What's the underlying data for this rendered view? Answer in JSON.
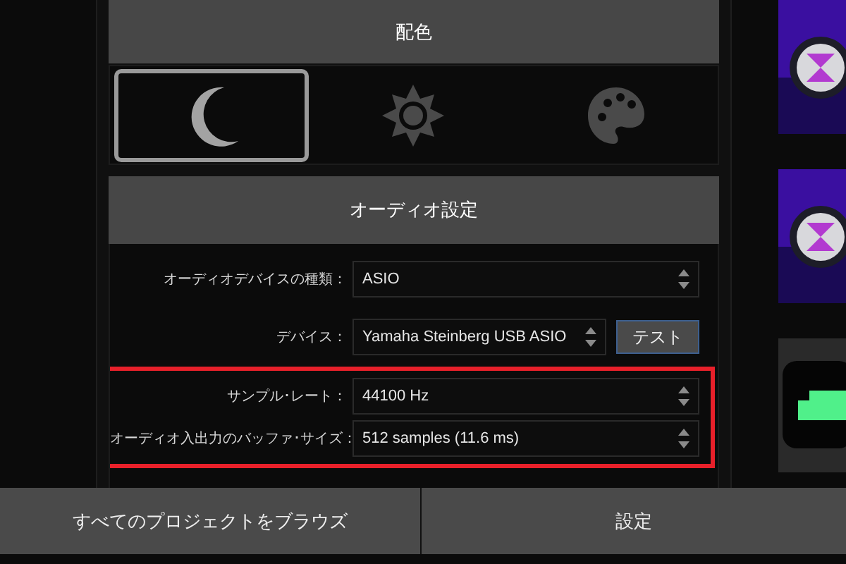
{
  "color_section": {
    "title": "配色",
    "themes": [
      {
        "kind": "moon",
        "selected": true
      },
      {
        "kind": "sun",
        "selected": false
      },
      {
        "kind": "palette",
        "selected": false
      }
    ]
  },
  "audio_section": {
    "title": "オーディオ設定",
    "rows": [
      {
        "label": "オーディオデバイスの種類：",
        "value": "ASIO",
        "highlighted": false
      },
      {
        "label": "デバイス：",
        "value": "Yamaha Steinberg USB ASIO",
        "button": "テスト",
        "highlighted": false
      },
      {
        "label": "サンプル･レート：",
        "value": "44100 Hz",
        "highlighted": true
      },
      {
        "label": "オーディオ入出力のバッファ･サイズ：",
        "value": "512 samples (11.6 ms)",
        "highlighted": true
      }
    ]
  },
  "bottom_bar": [
    {
      "label": "すべてのプロジェクトをブラウズ"
    },
    {
      "label": "設定"
    }
  ]
}
